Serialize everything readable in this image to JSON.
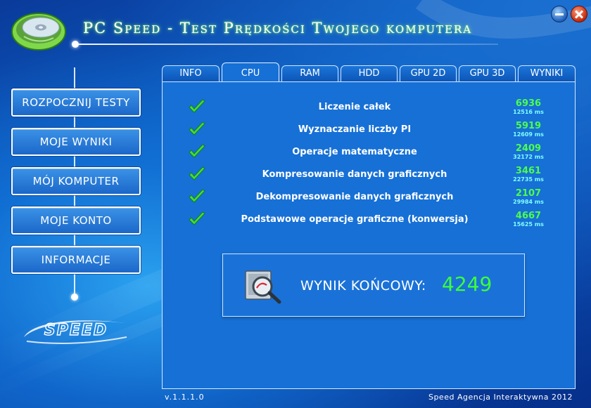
{
  "app": {
    "title": "PC Speed - Test Prędkości Twojego komputera",
    "brand_logo_text": "SPEED"
  },
  "window": {
    "minimize_icon": "minimize-icon",
    "close_icon": "close-icon"
  },
  "menu": {
    "items": [
      {
        "label": "ROZPOCZNIJ TESTY"
      },
      {
        "label": "MOJE WYNIKI"
      },
      {
        "label": "MÓJ KOMPUTER"
      },
      {
        "label": "MOJE KONTO"
      },
      {
        "label": "INFORMACJE"
      }
    ]
  },
  "tabs": {
    "active": "CPU",
    "items": [
      {
        "label": "INFO"
      },
      {
        "label": "CPU"
      },
      {
        "label": "RAM"
      },
      {
        "label": "HDD"
      },
      {
        "label": "GPU 2D"
      },
      {
        "label": "GPU 3D"
      },
      {
        "label": "WYNIKI"
      }
    ]
  },
  "tests": [
    {
      "label": "Liczenie całek",
      "score": "6936",
      "time": "12516 ms",
      "status_icon": "checkmark-icon"
    },
    {
      "label": "Wyznaczanie liczby PI",
      "score": "5919",
      "time": "12609 ms",
      "status_icon": "checkmark-icon"
    },
    {
      "label": "Operacje matematyczne",
      "score": "2409",
      "time": "32172 ms",
      "status_icon": "checkmark-icon"
    },
    {
      "label": "Kompresowanie danych graficznych",
      "score": "3461",
      "time": "22735 ms",
      "status_icon": "checkmark-icon"
    },
    {
      "label": "Dekompresowanie danych graficznych",
      "score": "2107",
      "time": "29984 ms",
      "status_icon": "checkmark-icon"
    },
    {
      "label": "Podstawowe operacje graficzne (konwersja)",
      "score": "4667",
      "time": "15625 ms",
      "status_icon": "checkmark-icon"
    }
  ],
  "result": {
    "label": "WYNIK KOŃCOWY:",
    "value": "4249",
    "icon": "magnifier-report-icon"
  },
  "footer": {
    "version": "v.1.1.1.0",
    "company": "Speed Agencja Interaktywna 2012"
  },
  "colors": {
    "score_green": "#4dff4d",
    "time_cyan": "#7fffff",
    "panel_blue": "#1670d6"
  }
}
